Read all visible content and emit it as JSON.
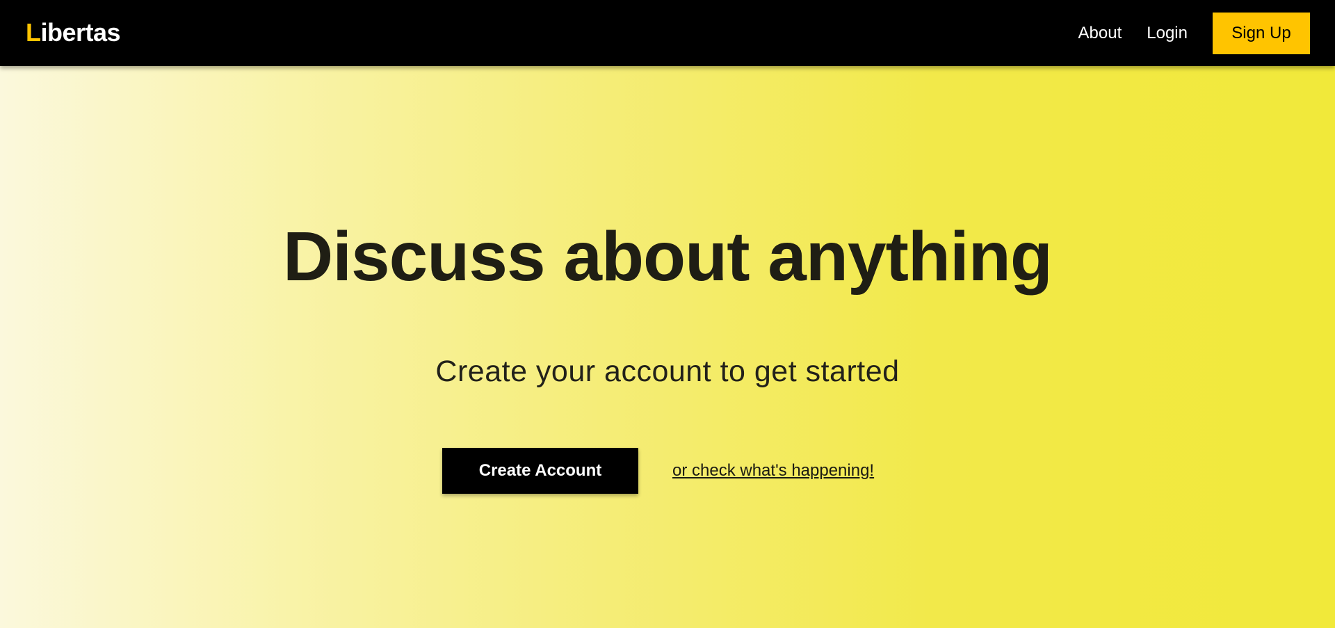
{
  "navbar": {
    "logo_accent": "L",
    "logo_rest": "ibertas",
    "links": {
      "about": "About",
      "login": "Login"
    },
    "signup_label": "Sign Up"
  },
  "hero": {
    "title": "Discuss about anything",
    "subtitle": "Create your account to get started",
    "create_account_label": "Create Account",
    "check_link_label": "or check what's happening!"
  },
  "colors": {
    "navbar_bg": "#000000",
    "accent_yellow": "#ffc400",
    "hero_gradient_start": "#fbf8dc",
    "hero_gradient_end": "#f1e93a",
    "text_dark": "#1f1e14"
  }
}
